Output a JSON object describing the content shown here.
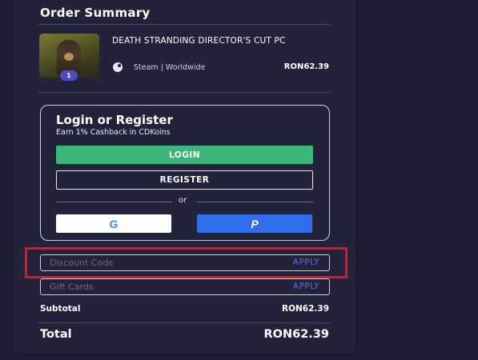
{
  "order_summary": {
    "title": "Order Summary",
    "item": {
      "name": "DEATH STRANDING DIRECTOR'S CUT PC",
      "quantity": "1",
      "platform_icon": "steam-icon",
      "platform": "Steam | Worldwide",
      "price": "RON62.39"
    }
  },
  "login": {
    "title": "Login or Register",
    "subtitle": "Earn 1% Cashback in CDKoins",
    "login_label": "LOGIN",
    "register_label": "REGISTER",
    "or_label": "or",
    "google_icon": "G",
    "paypal_icon": "P"
  },
  "discount": {
    "placeholder": "Discount Code",
    "apply_label": "APPLY"
  },
  "gift": {
    "placeholder": "Gift Cards",
    "apply_label": "APPLY"
  },
  "totals": {
    "subtotal_label": "Subtotal",
    "subtotal_value": "RON62.39",
    "total_label": "Total",
    "total_value": "RON62.39"
  },
  "colors": {
    "background": "#1c1b33",
    "panel": "#23223b",
    "login_button": "#3bb57a",
    "paypal_button": "#2f6ee8",
    "apply_link": "#5a6ee0",
    "highlight_box": "#e3141e"
  }
}
